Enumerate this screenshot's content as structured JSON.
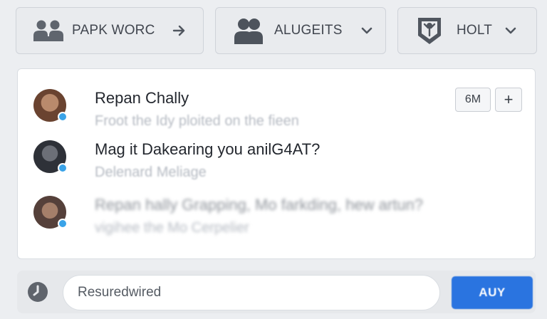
{
  "toolbar": {
    "btn1": {
      "label": "PAPK WORC",
      "icon": "group-icon",
      "tail_icon": "arrow-right-icon"
    },
    "btn2": {
      "label": "ALUGEITS",
      "icon": "users-icon",
      "tail_icon": "chevron-down-icon"
    },
    "btn3": {
      "label": "HOLT",
      "icon": "signpost-icon",
      "tail_icon": "chevron-down-icon"
    }
  },
  "messages": [
    {
      "title": "Repan Chally",
      "subtitle": "Froot the Idy ploited on the fieen",
      "online": true
    },
    {
      "title": "Mag it Dakearing you anilG4AT?",
      "subtitle": "Delenard Meliage",
      "online": true
    },
    {
      "title": "Repan hally Grapping, Mo farkding, hew artun?",
      "subtitle": "vigihee the Mo Cerpelier",
      "online": true
    }
  ],
  "card_actions": {
    "time_label": "6M",
    "add_label": "+"
  },
  "composer": {
    "placeholder": "Resuredwired",
    "send_label": "AUY",
    "clock_icon": "clock-icon"
  },
  "colors": {
    "accent": "#2a74e0",
    "online": "#3aa3e8",
    "background": "#eceef1",
    "card": "#ffffff"
  }
}
